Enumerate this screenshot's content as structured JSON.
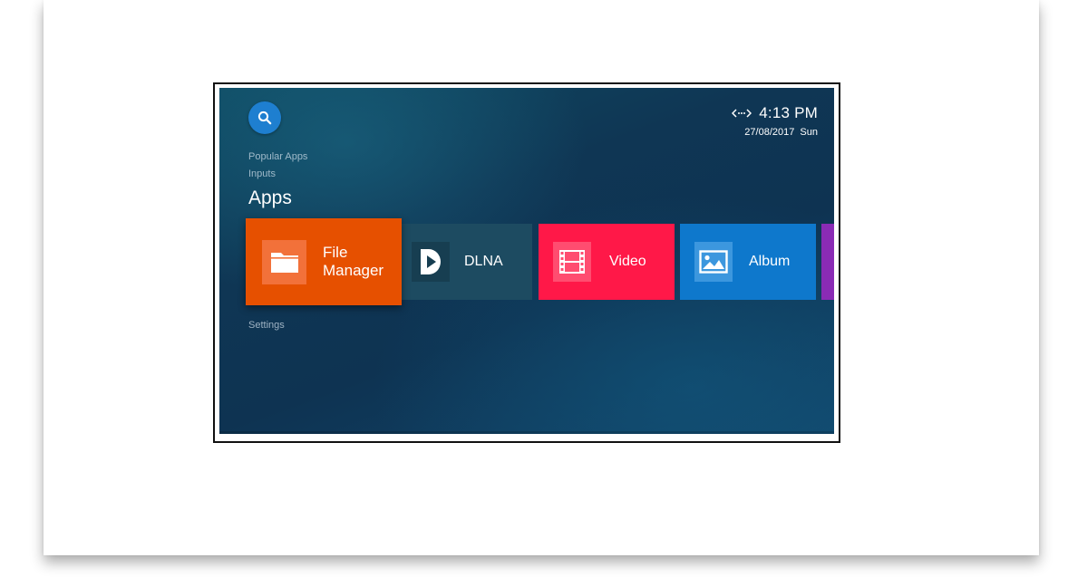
{
  "tv": {
    "status": {
      "network_icon": "ethernet-icon",
      "time": "4:13 PM",
      "date": "27/08/2017",
      "day": "Sun"
    },
    "search": {
      "icon": "search-icon"
    },
    "nav": {
      "popular_apps": "Popular Apps",
      "inputs": "Inputs",
      "settings": "Settings"
    },
    "section_title": "Apps",
    "apps": [
      {
        "label": "File\nManager",
        "icon": "folder-icon",
        "color": "#e65000",
        "focused": true
      },
      {
        "label": "DLNA",
        "icon": "dlna-icon",
        "color": "#1d4b61"
      },
      {
        "label": "Video",
        "icon": "film-icon",
        "color": "#ff1848"
      },
      {
        "label": "Album",
        "icon": "image-icon",
        "color": "#0e78cc"
      },
      {
        "label": "",
        "icon": "",
        "color": "#8a2bb5"
      }
    ]
  },
  "colors": {
    "screen_background": "#0f3654",
    "search_button": "#1e7fd0"
  }
}
